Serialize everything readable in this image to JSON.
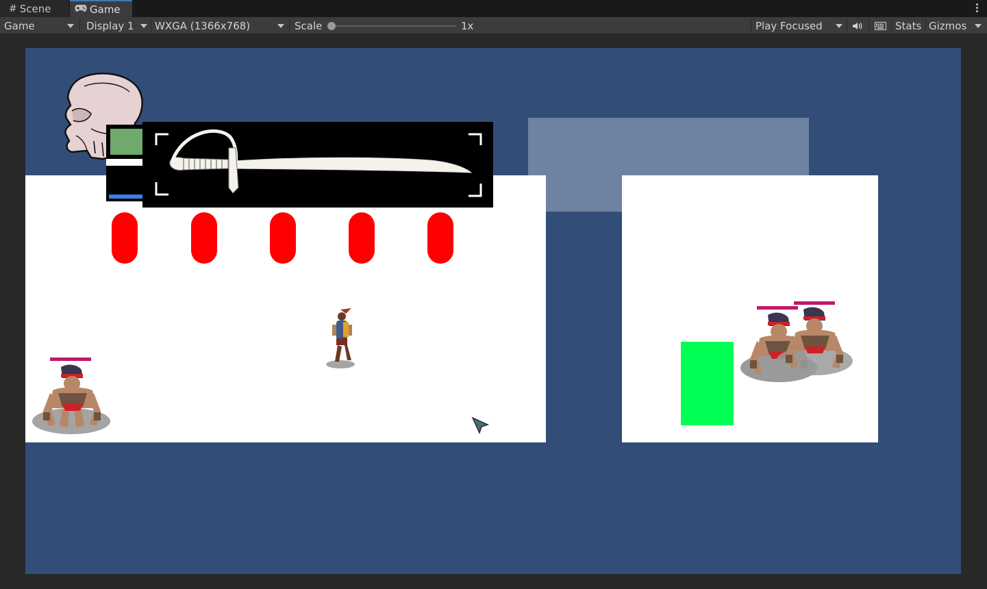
{
  "tabs": {
    "scene_label": "Scene",
    "game_label": "Game",
    "scene_icon": "hash-icon",
    "game_icon": "gamepad-icon"
  },
  "toolbar": {
    "view_mode": "Game",
    "display": "Display 1",
    "resolution": "WXGA (1366x768)",
    "scale_label": "Scale",
    "scale_value": "1x",
    "scale_fraction": 0,
    "play_mode": "Play Focused",
    "stats_label": "Stats",
    "gizmos_label": "Gizmos"
  },
  "game": {
    "background_color": "#324e78",
    "ammo_pills": 5,
    "weapon": "cutlass",
    "player_health_fill_color": "#6fa96c",
    "player_stamina_fill_color": "#3a7ee6",
    "enemy_hp_color": "#c2186b",
    "exit_zone_color": "#00ff55"
  }
}
